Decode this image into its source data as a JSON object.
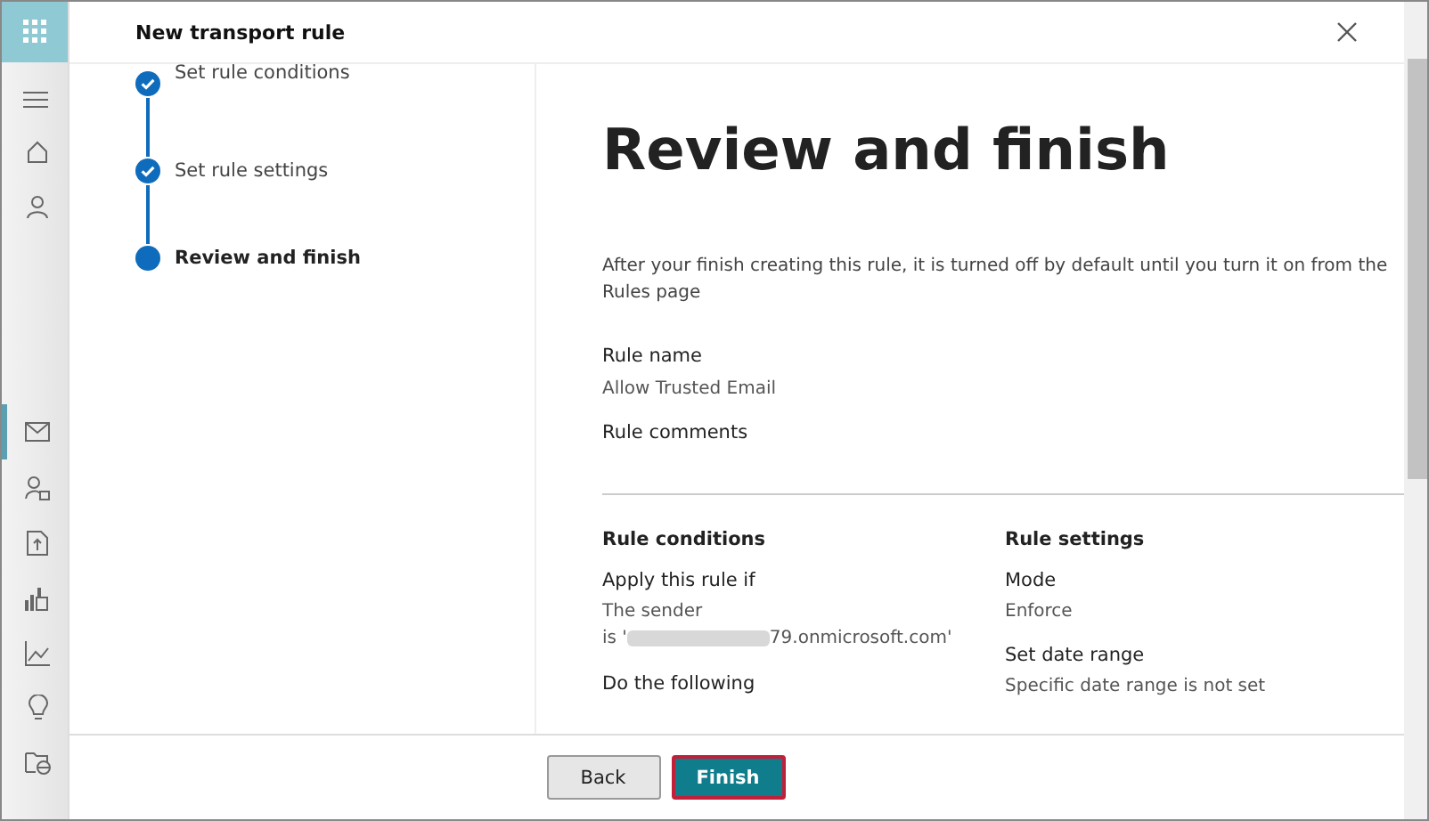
{
  "window": {
    "title": "New transport rule"
  },
  "nav_rail": {
    "items": [
      {
        "kind": "home",
        "selected": false
      },
      {
        "kind": "person",
        "selected": false
      },
      {
        "kind": "mail",
        "selected": true
      },
      {
        "kind": "person-admin",
        "selected": false
      },
      {
        "kind": "document",
        "selected": false
      },
      {
        "kind": "reports",
        "selected": false
      },
      {
        "kind": "chart",
        "selected": false
      },
      {
        "kind": "bulb",
        "selected": false
      },
      {
        "kind": "folder",
        "selected": false
      }
    ]
  },
  "steps": [
    {
      "label": "Set rule conditions",
      "done": true,
      "selected": false
    },
    {
      "label": "Set rule settings",
      "done": true,
      "selected": false
    },
    {
      "label": "Review and finish",
      "done": false,
      "selected": true
    }
  ],
  "heading": "Review and finish",
  "intro": "After your finish creating this rule, it is turned off by default until you turn it on from the Rules page",
  "rule_name": {
    "label": "Rule name",
    "value": "Allow Trusted Email"
  },
  "rule_comments": {
    "label": "Rule comments"
  },
  "rule_conditions": {
    "title": "Rule conditions",
    "apply_label": "Apply this rule if",
    "sender_line": "The sender",
    "sender_prefix": "is '",
    "sender_suffix": "79.onmicrosoft.com'",
    "do_label": "Do the following"
  },
  "rule_settings": {
    "title": "Rule settings",
    "mode_label": "Mode",
    "mode_value": "Enforce",
    "date_label": "Set date range",
    "date_value": "Specific date range is not set"
  },
  "buttons": [
    {
      "label": "Back",
      "kind": "secondary"
    },
    {
      "label": "Finish",
      "kind": "primary"
    }
  ]
}
